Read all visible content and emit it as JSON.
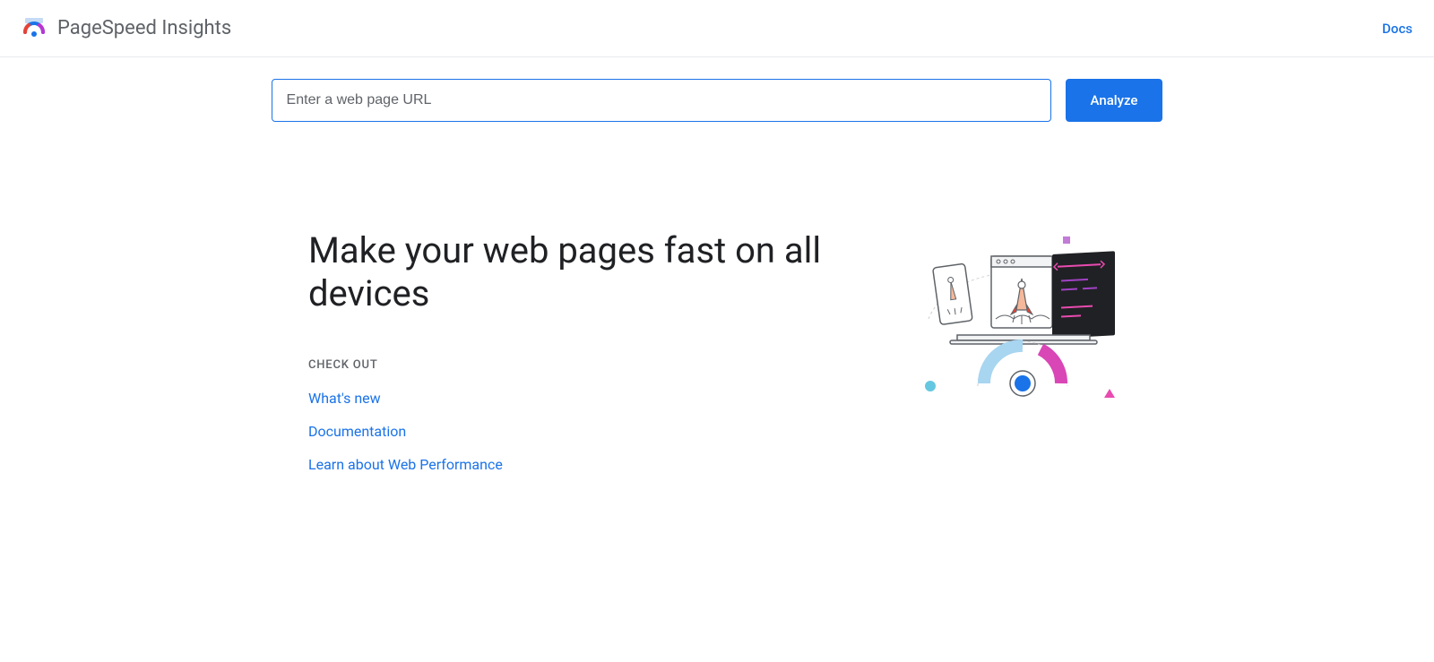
{
  "header": {
    "title": "PageSpeed Insights",
    "docs_label": "Docs"
  },
  "search": {
    "placeholder": "Enter a web page URL",
    "value": "",
    "button_label": "Analyze"
  },
  "main": {
    "headline": "Make your web pages fast on all devices",
    "checkout_label": "CHECK OUT",
    "links": [
      {
        "label": "What's new"
      },
      {
        "label": "Documentation"
      },
      {
        "label": "Learn about Web Performance"
      }
    ]
  }
}
